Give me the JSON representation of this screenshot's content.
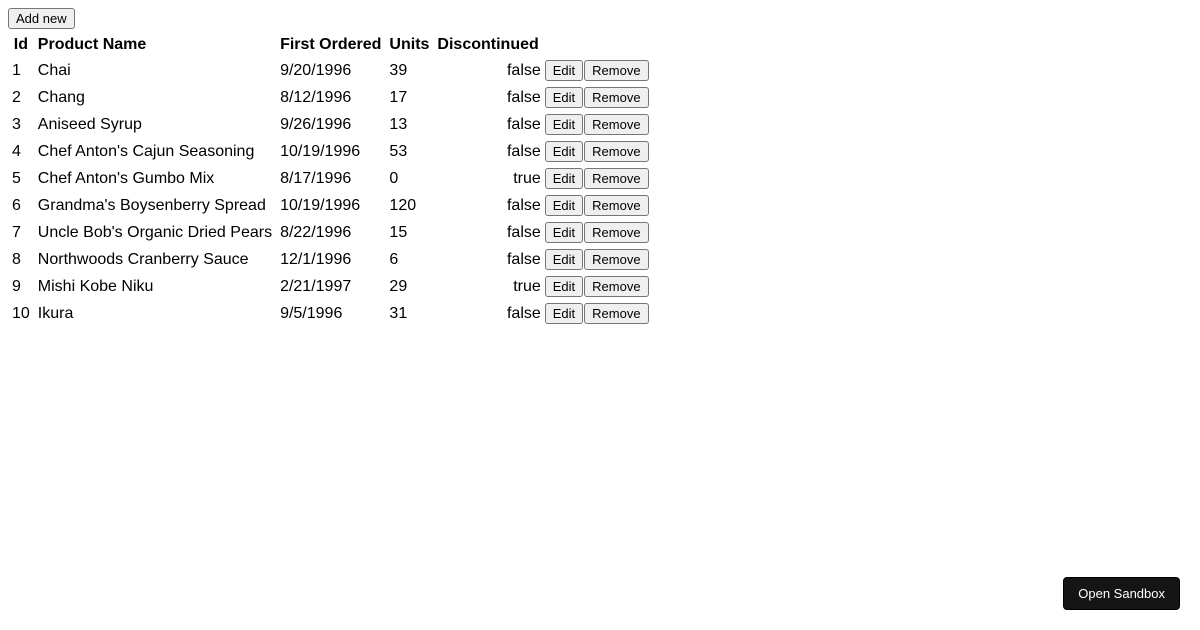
{
  "toolbar": {
    "add_new_label": "Add new"
  },
  "table": {
    "headers": {
      "id": "Id",
      "product_name": "Product Name",
      "first_ordered": "First Ordered",
      "units": "Units",
      "discontinued": "Discontinued"
    },
    "row_actions": {
      "edit": "Edit",
      "remove": "Remove"
    },
    "rows": [
      {
        "id": "1",
        "product_name": "Chai",
        "first_ordered": "9/20/1996",
        "units": "39",
        "discontinued": "false"
      },
      {
        "id": "2",
        "product_name": "Chang",
        "first_ordered": "8/12/1996",
        "units": "17",
        "discontinued": "false"
      },
      {
        "id": "3",
        "product_name": "Aniseed Syrup",
        "first_ordered": "9/26/1996",
        "units": "13",
        "discontinued": "false"
      },
      {
        "id": "4",
        "product_name": "Chef Anton's Cajun Seasoning",
        "first_ordered": "10/19/1996",
        "units": "53",
        "discontinued": "false"
      },
      {
        "id": "5",
        "product_name": "Chef Anton's Gumbo Mix",
        "first_ordered": "8/17/1996",
        "units": "0",
        "discontinued": "true"
      },
      {
        "id": "6",
        "product_name": "Grandma's Boysenberry Spread",
        "first_ordered": "10/19/1996",
        "units": "120",
        "discontinued": "false"
      },
      {
        "id": "7",
        "product_name": "Uncle Bob's Organic Dried Pears",
        "first_ordered": "8/22/1996",
        "units": "15",
        "discontinued": "false"
      },
      {
        "id": "8",
        "product_name": "Northwoods Cranberry Sauce",
        "first_ordered": "12/1/1996",
        "units": "6",
        "discontinued": "false"
      },
      {
        "id": "9",
        "product_name": "Mishi Kobe Niku",
        "first_ordered": "2/21/1997",
        "units": "29",
        "discontinued": "true"
      },
      {
        "id": "10",
        "product_name": "Ikura",
        "first_ordered": "9/5/1996",
        "units": "31",
        "discontinued": "false"
      }
    ]
  },
  "footer": {
    "open_sandbox_label": "Open Sandbox"
  }
}
